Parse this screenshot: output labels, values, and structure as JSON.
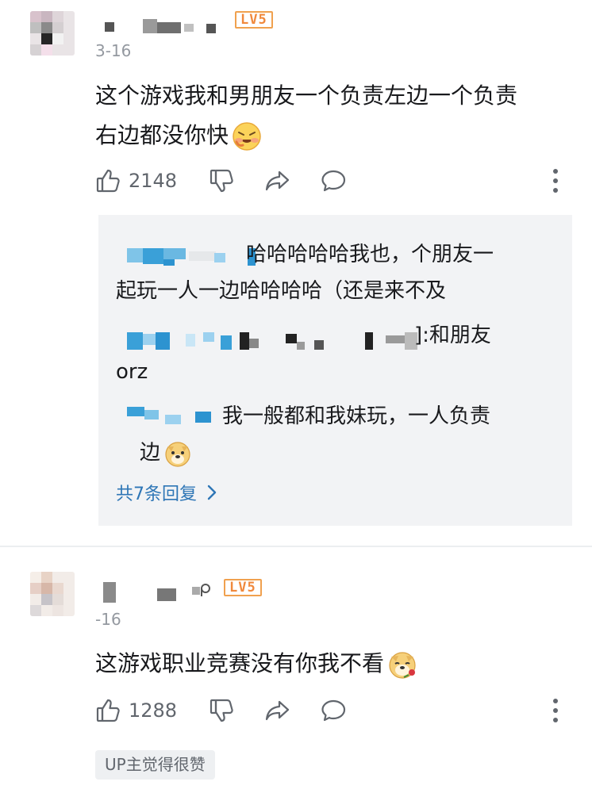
{
  "comments": [
    {
      "level_badge": "LV5",
      "date": "3-16",
      "text_lines": [
        "这个游戏我和男朋友一个负责左边一个负责",
        "右边都没你快"
      ],
      "emoji": "laughing-crying-emoji",
      "likes": "2148",
      "replies": {
        "items": [
          {
            "text_lines": [
              "哈哈哈哈哈我也，个朋友一",
              "起玩一人一边哈哈哈哈（还是来不及"
            ]
          },
          {
            "text_lines": [
              "]:和朋友",
              "orz"
            ]
          },
          {
            "text_lines": [
              "我一般都和我妹玩，一人负责",
              "边"
            ],
            "emoji": "doge-emoji"
          }
        ],
        "more_label": "共7条回复"
      }
    },
    {
      "level_badge": "LV5",
      "date": "-16",
      "text_lines": [
        "这游戏职业竞赛没有你我不看"
      ],
      "emoji": "doge-rose-emoji",
      "likes": "1288",
      "up_badge": "UP主觉得很赞"
    }
  ],
  "colors": {
    "text": "#18191c",
    "secondary": "#9499a0",
    "icon": "#61666d",
    "link": "#2e76b6",
    "level_badge": "#f0893c",
    "reply_bg": "#f2f3f5"
  },
  "icons": [
    "thumbs-up-icon",
    "thumbs-down-icon",
    "share-icon",
    "comment-icon",
    "more-icon",
    "chevron-right-icon"
  ]
}
